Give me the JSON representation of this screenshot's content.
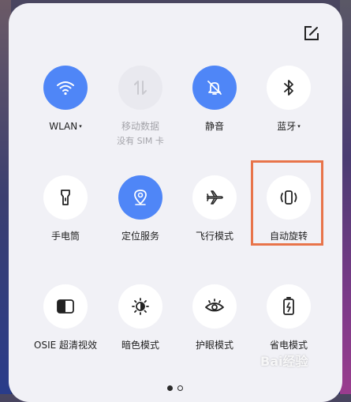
{
  "tiles": [
    {
      "label": "WLAN",
      "caret": "▾",
      "sub": "",
      "icon": "wifi-icon",
      "state": "on"
    },
    {
      "label": "移动数据",
      "caret": "",
      "sub": "没有 SIM 卡",
      "icon": "mobile-data-icon",
      "state": "disabled"
    },
    {
      "label": "静音",
      "caret": "",
      "sub": "",
      "icon": "bell-off-icon",
      "state": "on"
    },
    {
      "label": "蓝牙",
      "caret": "▾",
      "sub": "",
      "icon": "bluetooth-icon",
      "state": "off"
    },
    {
      "label": "手电筒",
      "caret": "",
      "sub": "",
      "icon": "flashlight-icon",
      "state": "off"
    },
    {
      "label": "定位服务",
      "caret": "",
      "sub": "",
      "icon": "location-icon",
      "state": "on"
    },
    {
      "label": "飞行模式",
      "caret": "",
      "sub": "",
      "icon": "airplane-icon",
      "state": "off"
    },
    {
      "label": "自动旋转",
      "caret": "",
      "sub": "",
      "icon": "auto-rotate-icon",
      "state": "off"
    },
    {
      "label": "OSIE 超清视效",
      "caret": "",
      "sub": "",
      "icon": "contrast-icon",
      "state": "off"
    },
    {
      "label": "暗色模式",
      "caret": "",
      "sub": "",
      "icon": "dark-mode-icon",
      "state": "off"
    },
    {
      "label": "护眼模式",
      "caret": "",
      "sub": "",
      "icon": "eye-icon",
      "state": "off"
    },
    {
      "label": "省电模式",
      "caret": "",
      "sub": "",
      "icon": "battery-saver-icon",
      "state": "off"
    }
  ],
  "pager": {
    "pages": 2,
    "current": 1
  },
  "colors": {
    "accent": "#4f86f7",
    "highlight": "#e8744a",
    "panel": "#f1f1f6"
  },
  "watermark": "Bai经验"
}
